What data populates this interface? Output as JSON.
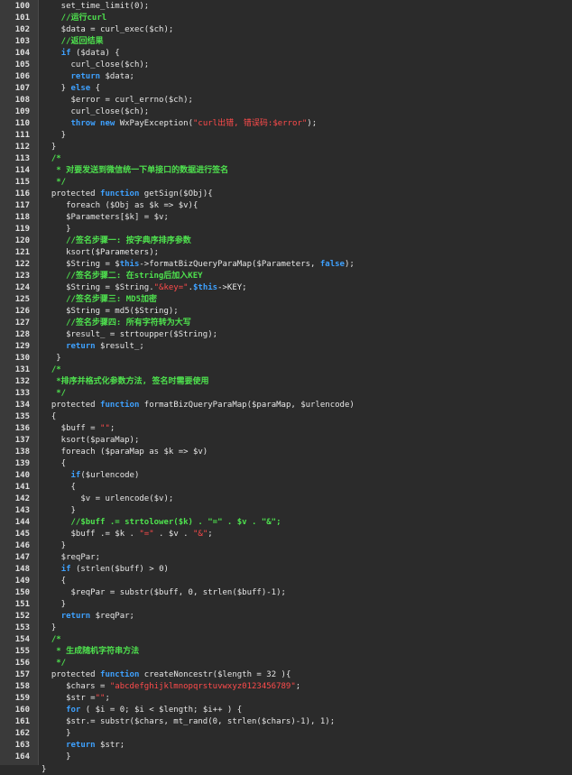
{
  "editor": {
    "lines": [
      {
        "n": "100",
        "t": [
          [
            "p",
            "    set_time_limit(0);"
          ]
        ]
      },
      {
        "n": "101",
        "t": [
          [
            "c",
            "    //运行curl"
          ]
        ]
      },
      {
        "n": "102",
        "t": [
          [
            "p",
            "    $data = curl_exec($ch);"
          ]
        ]
      },
      {
        "n": "103",
        "t": [
          [
            "c",
            "    //返回结果"
          ]
        ]
      },
      {
        "n": "104",
        "t": [
          [
            "p",
            "    "
          ],
          [
            "k",
            "if"
          ],
          [
            "p",
            " ($data) {"
          ]
        ]
      },
      {
        "n": "105",
        "t": [
          [
            "p",
            "      curl_close($ch);"
          ]
        ]
      },
      {
        "n": "106",
        "t": [
          [
            "p",
            "      "
          ],
          [
            "k",
            "return"
          ],
          [
            "p",
            " $data;"
          ]
        ]
      },
      {
        "n": "107",
        "t": [
          [
            "p",
            "    } "
          ],
          [
            "k",
            "else"
          ],
          [
            "p",
            " {"
          ]
        ]
      },
      {
        "n": "108",
        "t": [
          [
            "p",
            "      $error = curl_errno($ch);"
          ]
        ]
      },
      {
        "n": "109",
        "t": [
          [
            "p",
            "      curl_close($ch);"
          ]
        ]
      },
      {
        "n": "110",
        "t": [
          [
            "p",
            "      "
          ],
          [
            "k",
            "throw"
          ],
          [
            "p",
            " "
          ],
          [
            "k",
            "new"
          ],
          [
            "p",
            " WxPayException("
          ],
          [
            "s",
            "\"curl出错, 错误码:$error\""
          ],
          [
            "p",
            ");"
          ]
        ]
      },
      {
        "n": "111",
        "t": [
          [
            "p",
            "    }"
          ]
        ]
      },
      {
        "n": "112",
        "t": [
          [
            "p",
            "  }"
          ]
        ]
      },
      {
        "n": "113",
        "t": [
          [
            "c",
            "  /*"
          ]
        ]
      },
      {
        "n": "114",
        "t": [
          [
            "c",
            "   * 对要发送到微信统一下单接口的数据进行签名"
          ]
        ]
      },
      {
        "n": "115",
        "t": [
          [
            "c",
            "   */"
          ]
        ]
      },
      {
        "n": "116",
        "t": [
          [
            "p",
            "  protected "
          ],
          [
            "k",
            "function"
          ],
          [
            "p",
            " getSign($Obj){"
          ]
        ]
      },
      {
        "n": "117",
        "t": [
          [
            "p",
            "     foreach ($Obj as $k => $v){"
          ]
        ]
      },
      {
        "n": "118",
        "t": [
          [
            "p",
            "     $Parameters[$k] = $v;"
          ]
        ]
      },
      {
        "n": "119",
        "t": [
          [
            "p",
            "     }"
          ]
        ]
      },
      {
        "n": "120",
        "t": [
          [
            "c",
            "     //签名步骤一: 按字典序排序参数"
          ]
        ]
      },
      {
        "n": "121",
        "t": [
          [
            "p",
            "     ksort($Parameters);"
          ]
        ]
      },
      {
        "n": "122",
        "t": [
          [
            "p",
            "     $String = $"
          ],
          [
            "k",
            "this"
          ],
          [
            "p",
            "->formatBizQueryParaMap($Parameters, "
          ],
          [
            "k",
            "false"
          ],
          [
            "p",
            ");"
          ]
        ]
      },
      {
        "n": "123",
        "t": [
          [
            "c",
            "     //签名步骤二: 在string后加入KEY"
          ]
        ]
      },
      {
        "n": "124",
        "t": [
          [
            "p",
            "     $String = $String."
          ],
          [
            "s",
            "\"&key=\""
          ],
          [
            "p",
            "."
          ],
          [
            "k",
            "$this"
          ],
          [
            "p",
            "->KEY;"
          ]
        ]
      },
      {
        "n": "125",
        "t": [
          [
            "c",
            "     //签名步骤三: MD5加密"
          ]
        ]
      },
      {
        "n": "126",
        "t": [
          [
            "p",
            "     $String = md5($String);"
          ]
        ]
      },
      {
        "n": "127",
        "t": [
          [
            "c",
            "     //签名步骤四: 所有字符转为大写"
          ]
        ]
      },
      {
        "n": "128",
        "t": [
          [
            "p",
            "     $result_ = strtoupper($String);"
          ]
        ]
      },
      {
        "n": "129",
        "t": [
          [
            "p",
            "     "
          ],
          [
            "k",
            "return"
          ],
          [
            "p",
            " $result_;"
          ]
        ]
      },
      {
        "n": "130",
        "t": [
          [
            "p",
            "   }"
          ]
        ]
      },
      {
        "n": "131",
        "t": [
          [
            "c",
            "  /*"
          ]
        ]
      },
      {
        "n": "132",
        "t": [
          [
            "c",
            "   *排序并格式化参数方法, 签名时需要使用"
          ]
        ]
      },
      {
        "n": "133",
        "t": [
          [
            "c",
            "   */"
          ]
        ]
      },
      {
        "n": "134",
        "t": [
          [
            "p",
            "  protected "
          ],
          [
            "k",
            "function"
          ],
          [
            "p",
            " formatBizQueryParaMap($paraMap, $urlencode)"
          ]
        ]
      },
      {
        "n": "135",
        "t": [
          [
            "p",
            "  {"
          ]
        ]
      },
      {
        "n": "136",
        "t": [
          [
            "p",
            "    $buff = "
          ],
          [
            "s",
            "\"\""
          ],
          [
            "p",
            ";"
          ]
        ]
      },
      {
        "n": "137",
        "t": [
          [
            "p",
            "    ksort($paraMap);"
          ]
        ]
      },
      {
        "n": "138",
        "t": [
          [
            "p",
            "    foreach ($paraMap as $k => $v)"
          ]
        ]
      },
      {
        "n": "139",
        "t": [
          [
            "p",
            "    {"
          ]
        ]
      },
      {
        "n": "140",
        "t": [
          [
            "p",
            "      "
          ],
          [
            "k",
            "if"
          ],
          [
            "p",
            "($urlencode)"
          ]
        ]
      },
      {
        "n": "141",
        "t": [
          [
            "p",
            "      {"
          ]
        ]
      },
      {
        "n": "142",
        "t": [
          [
            "p",
            "        $v = urlencode($v);"
          ]
        ]
      },
      {
        "n": "143",
        "t": [
          [
            "p",
            "      }"
          ]
        ]
      },
      {
        "n": "144",
        "t": [
          [
            "c",
            "      //$buff .= strtolower($k) . \"=\" . $v . \"&\";"
          ]
        ]
      },
      {
        "n": "145",
        "t": [
          [
            "p",
            "      $buff .= $k . "
          ],
          [
            "s",
            "\"=\""
          ],
          [
            "p",
            " . $v . "
          ],
          [
            "s",
            "\"&\""
          ],
          [
            "p",
            ";"
          ]
        ]
      },
      {
        "n": "146",
        "t": [
          [
            "p",
            "    }"
          ]
        ]
      },
      {
        "n": "147",
        "t": [
          [
            "p",
            "    $reqPar;"
          ]
        ]
      },
      {
        "n": "148",
        "t": [
          [
            "p",
            "    "
          ],
          [
            "k",
            "if"
          ],
          [
            "p",
            " (strlen($buff) > 0)"
          ]
        ]
      },
      {
        "n": "149",
        "t": [
          [
            "p",
            "    {"
          ]
        ]
      },
      {
        "n": "150",
        "t": [
          [
            "p",
            "      $reqPar = substr($buff, 0, strlen($buff)-1);"
          ]
        ]
      },
      {
        "n": "151",
        "t": [
          [
            "p",
            "    }"
          ]
        ]
      },
      {
        "n": "152",
        "t": [
          [
            "p",
            "    "
          ],
          [
            "k",
            "return"
          ],
          [
            "p",
            " $reqPar;"
          ]
        ]
      },
      {
        "n": "153",
        "t": [
          [
            "p",
            "  }"
          ]
        ]
      },
      {
        "n": "154",
        "t": [
          [
            "c",
            "  /*"
          ]
        ]
      },
      {
        "n": "155",
        "t": [
          [
            "c",
            "   * 生成随机字符串方法"
          ]
        ]
      },
      {
        "n": "156",
        "t": [
          [
            "c",
            "   */"
          ]
        ]
      },
      {
        "n": "157",
        "t": [
          [
            "p",
            "  protected "
          ],
          [
            "k",
            "function"
          ],
          [
            "p",
            " createNoncestr($length = 32 ){"
          ]
        ]
      },
      {
        "n": "158",
        "t": [
          [
            "p",
            "     $chars = "
          ],
          [
            "s",
            "\"abcdefghijklmnopqrstuvwxyz0123456789\""
          ],
          [
            "p",
            ";"
          ]
        ]
      },
      {
        "n": "159",
        "t": [
          [
            "p",
            "     $str ="
          ],
          [
            "s",
            "\"\""
          ],
          [
            "p",
            ";"
          ]
        ]
      },
      {
        "n": "160",
        "t": [
          [
            "p",
            "     "
          ],
          [
            "k",
            "for"
          ],
          [
            "p",
            " ( $i = 0; $i < $length; $i++ ) {"
          ]
        ]
      },
      {
        "n": "161",
        "t": [
          [
            "p",
            "     $str.= substr($chars, mt_rand(0, strlen($chars)-1), 1);"
          ]
        ]
      },
      {
        "n": "162",
        "t": [
          [
            "p",
            "     }"
          ]
        ]
      },
      {
        "n": "163",
        "t": [
          [
            "p",
            "     "
          ],
          [
            "k",
            "return"
          ],
          [
            "p",
            " $str;"
          ]
        ]
      },
      {
        "n": "164",
        "t": [
          [
            "p",
            "     }"
          ]
        ]
      }
    ],
    "tail": "}"
  }
}
